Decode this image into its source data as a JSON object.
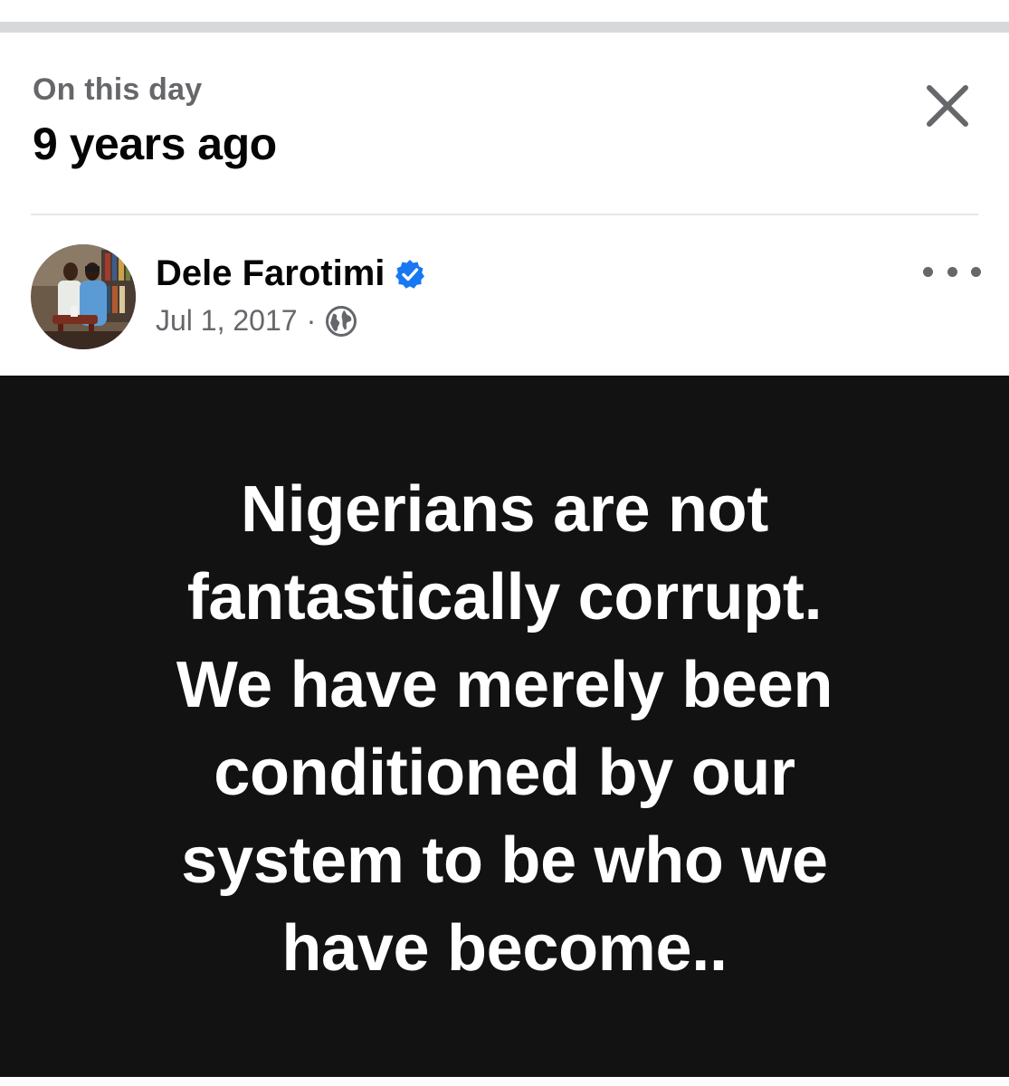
{
  "memory_header": {
    "kicker": "On this day",
    "headline": "9 years ago",
    "close_icon": "close-icon"
  },
  "post": {
    "author_name": "Dele Farotimi",
    "verified_icon": "verified-badge-icon",
    "date": "Jul 1, 2017",
    "separator": "·",
    "audience_icon": "globe-icon",
    "more_icon": "more-options-icon",
    "quote_text": "Nigerians are not\nfantastically corrupt.\nWe have merely been\nconditioned by our\nsystem to be  who we\nhave become..",
    "card_background": "#121212",
    "card_text_color": "#ffffff"
  },
  "colors": {
    "secondary_text": "#65676b",
    "primary_text": "#050505",
    "verified_blue": "#1877f2"
  }
}
